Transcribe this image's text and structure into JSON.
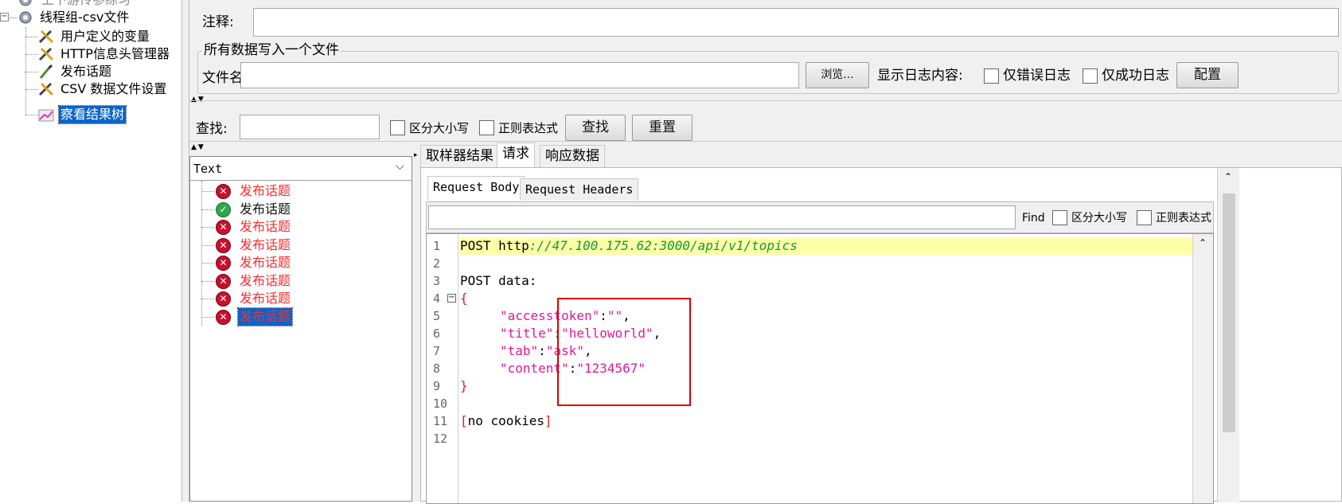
{
  "tree": {
    "partial_top": "上下游传参练习",
    "thread_group": "线程组-csv文件",
    "items": [
      {
        "label": "用户定义的变量",
        "icon": "wrench-scissors-icon"
      },
      {
        "label": "HTTP信息头管理器",
        "icon": "wrench-scissors-icon"
      },
      {
        "label": "发布话题",
        "icon": "pipette-icon"
      },
      {
        "label": "CSV 数据文件设置",
        "icon": "wrench-scissors-icon"
      },
      {
        "label": "察看结果树",
        "icon": "graph-icon",
        "selected": true
      }
    ]
  },
  "comment": {
    "label": "注释:",
    "value": ""
  },
  "write_all": {
    "group_title": "所有数据写入一个文件",
    "file_label": "文件名",
    "file_value": "",
    "browse_button": "浏览...",
    "log_label": "显示日志内容:",
    "errors_only": "仅错误日志",
    "success_only": "仅成功日志",
    "config_button": "配置"
  },
  "search": {
    "label": "查找:",
    "value": "",
    "case_sensitive": "区分大小写",
    "regex": "正则表达式",
    "find_button": "查找",
    "reset_button": "重置"
  },
  "renderer": {
    "selected": "Text"
  },
  "results": [
    {
      "label": "发布话题",
      "status": "error"
    },
    {
      "label": "发布话题",
      "status": "success"
    },
    {
      "label": "发布话题",
      "status": "error"
    },
    {
      "label": "发布话题",
      "status": "error"
    },
    {
      "label": "发布话题",
      "status": "error"
    },
    {
      "label": "发布话题",
      "status": "error"
    },
    {
      "label": "发布话题",
      "status": "error"
    },
    {
      "label": "发布话题",
      "status": "error",
      "selected": true
    }
  ],
  "tabs": [
    "取样器结果",
    "请求",
    "响应数据"
  ],
  "active_tab": "请求",
  "subtabs": [
    "Request Body",
    "Request Headers"
  ],
  "active_subtab": "Request Body",
  "find_bar": {
    "value": "",
    "find_label": "Find",
    "case_sensitive": "区分大小写",
    "regex": "正则表达式"
  },
  "code": {
    "line_numbers": [
      "1",
      "2",
      "3",
      "4",
      "5",
      "6",
      "7",
      "8",
      "9",
      "10",
      "11",
      "12"
    ],
    "line1_method": "POST ",
    "line1_scheme": "http",
    "line1_url": "://47.100.175.62:3000/api/v1/topics",
    "line3": "POST data:",
    "line4": "{",
    "line5_key": "\"accesstoken\"",
    "line5_sep": ":",
    "line5_val": "\"\"",
    "line5_end": ",",
    "line6_key": "\"title\"",
    "line6_sep": ":",
    "line6_val": "\"helloworld\"",
    "line6_end": ",",
    "line7_key": "\"tab\"",
    "line7_sep": ":",
    "line7_val": "\"ask\"",
    "line7_end": ",",
    "line8_key": "\"content\"",
    "line8_sep": ":",
    "line8_val": "\"1234567\"",
    "line9": "}",
    "line11_open": "[",
    "line11_text": "no cookies",
    "line11_close": "]"
  },
  "colors": {
    "selection": "#0a64c8",
    "error_text": "#ff2b2b",
    "highlight_line": "#ffffa8",
    "url": "#0d9c3a",
    "json": "#e0199a",
    "annotation_box": "#e00000"
  }
}
